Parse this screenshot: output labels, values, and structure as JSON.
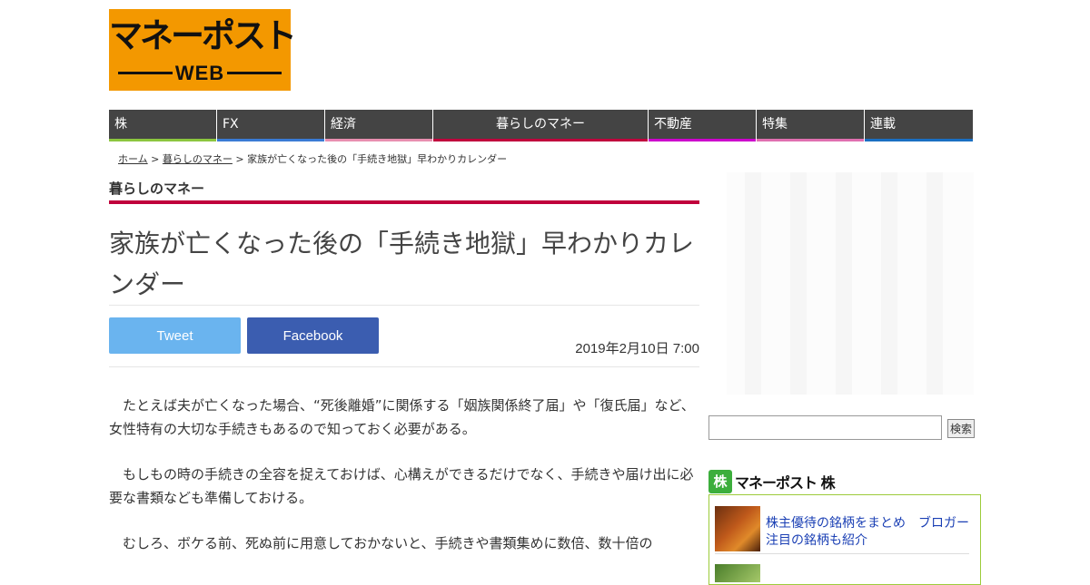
{
  "logo": {
    "main": "マネーポスト",
    "sub": "WEB"
  },
  "nav": [
    {
      "label": "株",
      "color": "#8cc63f",
      "width": 118
    },
    {
      "label": "FX",
      "color": "#3a7bd5",
      "width": 118
    },
    {
      "label": "経済",
      "color": "#e88fb0",
      "width": 118
    },
    {
      "label": "暮らしのマネー",
      "color": "#c0003c",
      "width": 236,
      "center": true
    },
    {
      "label": "不動産",
      "color": "#cc00cc",
      "width": 118
    },
    {
      "label": "特集",
      "color": "#e070b0",
      "width": 118
    },
    {
      "label": "連載",
      "color": "#1a6fc2",
      "width": 119
    }
  ],
  "breadcrumb": {
    "home": "ホーム",
    "sep": " > ",
    "category": "暮らしのマネー",
    "current": "家族が亡くなった後の「手続き地獄」早わかりカレンダー"
  },
  "section_title": "暮らしのマネー",
  "headline": "家族が亡くなった後の「手続き地獄」早わかりカレンダー",
  "share": {
    "tweet": "Tweet",
    "facebook": "Facebook"
  },
  "date": "2019年2月10日 7:00",
  "paragraphs": [
    "たとえば夫が亡くなった場合、“死後離婚”に関係する「姻族関係終了届」や「復氏届」など、女性特有の大切な手続きもあるので知っておく必要がある。",
    "もしもの時の手続きの全容を捉えておけば、心構えができるだけでなく、手続きや届け出に必要な書類なども準備しておける。",
    "むしろ、ボケる前、死ぬ前に用意しておかないと、手続きや書類集めに数倍、数十倍の"
  ],
  "search": {
    "button": "検索",
    "value": ""
  },
  "kabu": {
    "icon": "株",
    "title": "マネーポスト 株",
    "items": [
      {
        "text": "株主優待の銘柄をまとめ　ブロガー注目の銘柄も紹介"
      }
    ]
  },
  "colors": {
    "accent": "#c0003c",
    "logo_bg": "#f39800",
    "nav_bg": "#444444"
  }
}
